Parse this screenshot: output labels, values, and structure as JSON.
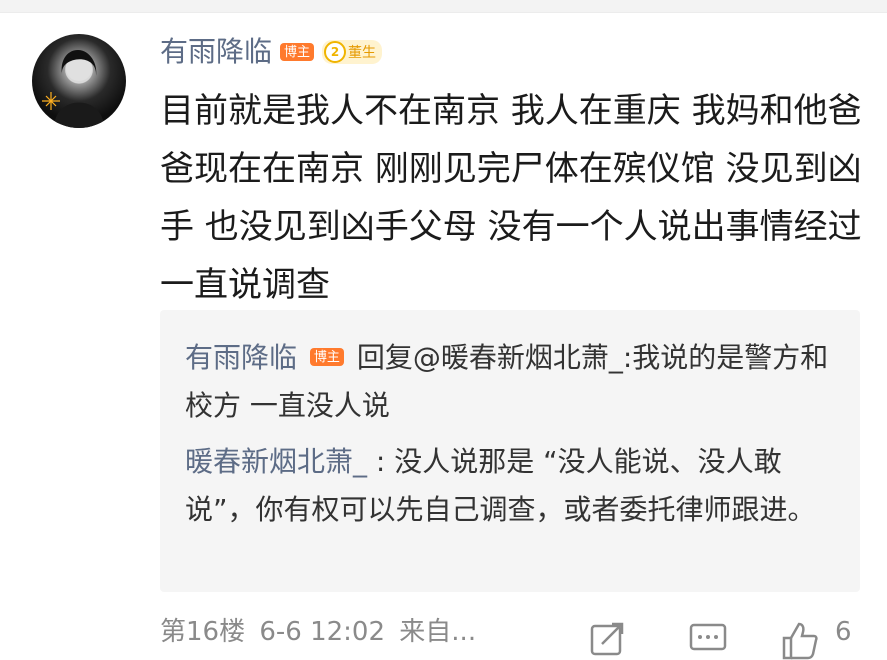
{
  "comment": {
    "username": "有雨降临",
    "blogger_badge": "博主",
    "level_number": "2",
    "level_label": "董生",
    "text": "目前就是我人不在南京 我人在重庆 我妈和他爸爸现在在南京 刚刚见完尸体在殡仪馆 没见到凶手 也没见到凶手父母 没有一个人说出事情经过 一直说调查"
  },
  "replies": [
    {
      "name": "有雨降临",
      "badge": "博主",
      "text": " 回复@暖春新烟北萧_:我说的是警方和校方 一直没人说"
    },
    {
      "name": "暖春新烟北萧_",
      "text": ": 没人说那是 “没人能说、没人敢说”，你有权可以先自己调查，或者委托律师跟进。"
    }
  ],
  "footer": {
    "floor": "第16楼",
    "time": "6-6 12:02",
    "source": "来自...",
    "like_count": "6"
  },
  "icons": [
    "avatar",
    "share-icon",
    "comment-icon",
    "like-icon"
  ],
  "colors": {
    "name": "#5d6c86",
    "badge": "#ff7a2d",
    "reply_bg": "#f5f5f5"
  }
}
